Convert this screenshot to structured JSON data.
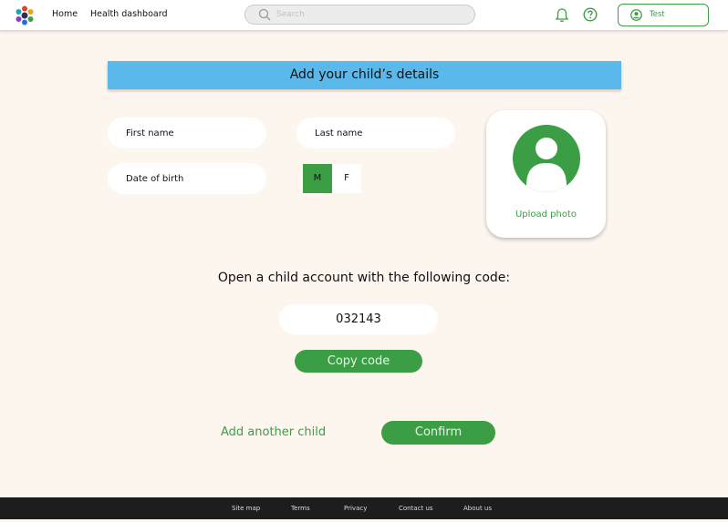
{
  "header": {
    "nav": {
      "home": "Home",
      "health_dashboard": "Health dashboard"
    },
    "search": {
      "placeholder": "Search"
    },
    "user": {
      "name": "Test"
    }
  },
  "form": {
    "title": "Add your child’s details",
    "first_name_placeholder": "First name",
    "last_name_placeholder": "Last name",
    "dob_placeholder": "Date of birth",
    "gender": {
      "options": [
        "M",
        "F"
      ],
      "selected": "M"
    },
    "upload_photo": "Upload photo"
  },
  "code": {
    "heading": "Open a child account with the following code:",
    "value": "032143",
    "copy_label": "Copy code"
  },
  "actions": {
    "add_another": "Add another child",
    "confirm": "Confirm"
  },
  "footer": {
    "links": [
      "Site map",
      "Terms",
      "Privacy",
      "Contact us",
      "About us"
    ]
  },
  "colors": {
    "accent_green": "#3b9e45",
    "banner_blue": "#5bb8ea",
    "page_bg": "#fdf6ef",
    "footer_bg": "#1d1d1d"
  }
}
